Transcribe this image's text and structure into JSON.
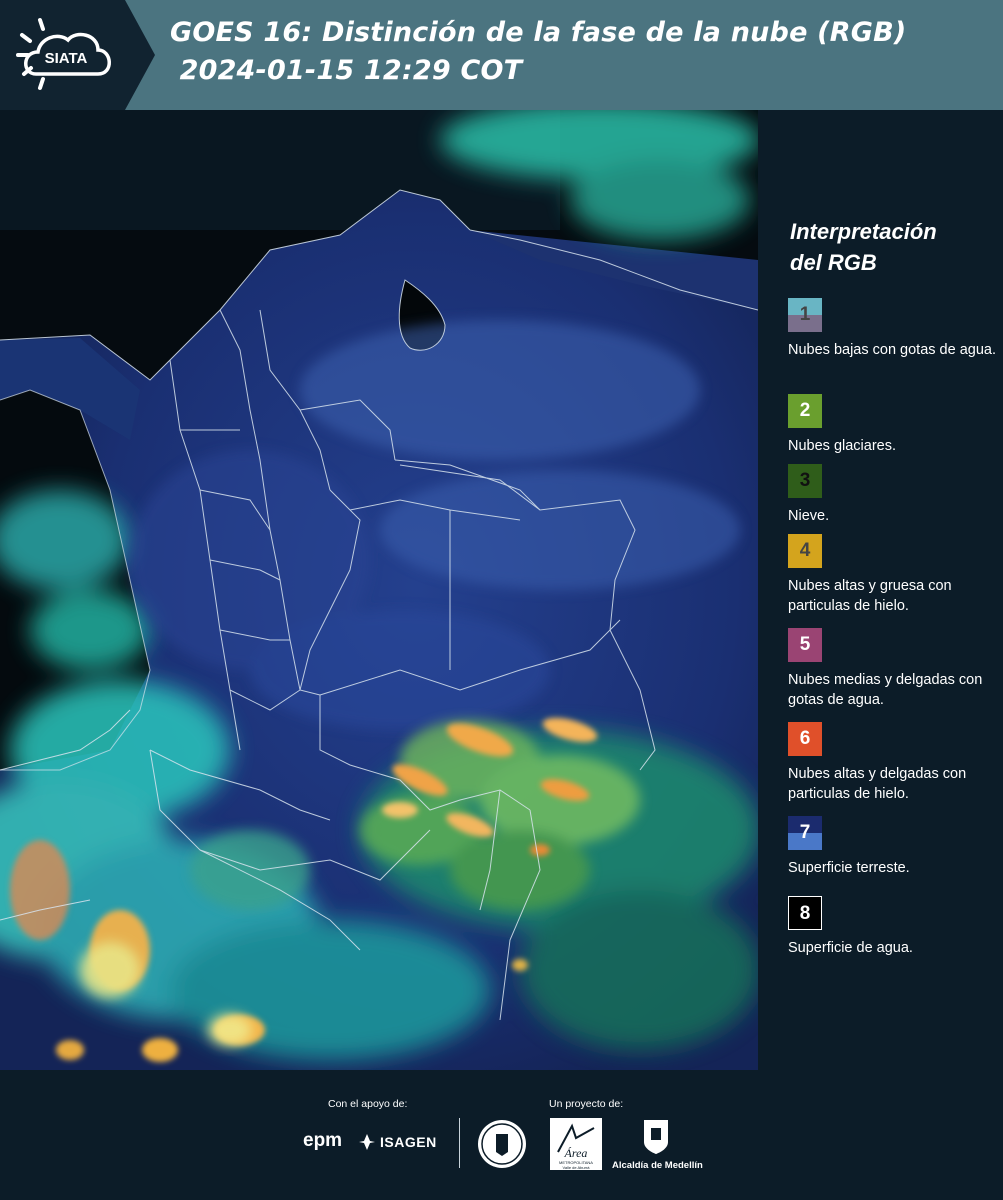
{
  "header": {
    "logo_text": "SIATA",
    "title_line1": "GOES 16: Distinción de la fase de la nube (RGB)",
    "title_line2": " 2024-01-15 12:29 COT"
  },
  "legend": {
    "title_line1": "Interpretación",
    "title_line2": "del RGB",
    "items": [
      {
        "num": "1",
        "text": "Nubes bajas con gotas de agua.",
        "color_top": "#69b5c4",
        "color_bottom": "#7a6f8c",
        "num_color": "#444444"
      },
      {
        "num": "2",
        "text": "Nubes glaciares.",
        "color_top": "#6a9f2e",
        "color_bottom": "#6a9f2e",
        "num_color": "#ffffff"
      },
      {
        "num": "3",
        "text": "Nieve.",
        "color_top": "#2f5d1a",
        "color_bottom": "#2f5d1a",
        "num_color": "#111111"
      },
      {
        "num": "4",
        "text": "Nubes altas y gruesa con particulas de hielo.",
        "color_top": "#d4a41d",
        "color_bottom": "#d4a41d",
        "num_color": "#444444"
      },
      {
        "num": "5",
        "text": "Nubes medias y delgadas con gotas de agua.",
        "color_top": "#9a4473",
        "color_bottom": "#9a4473",
        "num_color": "#ffffff"
      },
      {
        "num": "6",
        "text": "Nubes altas y delgadas con particulas de hielo.",
        "color_top": "#e0502a",
        "color_bottom": "#e0502a",
        "num_color": "#ffffff"
      },
      {
        "num": "7",
        "text": "Superficie terreste.",
        "color_top": "#1b2b6e",
        "color_bottom": "#4a78c8",
        "num_color": "#ffffff"
      },
      {
        "num": "8",
        "text": "Superficie de agua.",
        "color_top": "#000000",
        "color_bottom": "#000000",
        "num_color": "#ffffff"
      }
    ]
  },
  "footer": {
    "support_label": "Con el apoyo de:",
    "project_label": "Un proyecto de:",
    "epm": "epm",
    "isagen": "ISAGEN",
    "area_top": "Área",
    "area_bottom": "METROPOLITANA\nValle de Aburrá",
    "alcaldia": "Alcaldía de Medellín"
  },
  "colors": {
    "header_bg": "#4b7480",
    "panel_bg": "#0c1c28"
  }
}
